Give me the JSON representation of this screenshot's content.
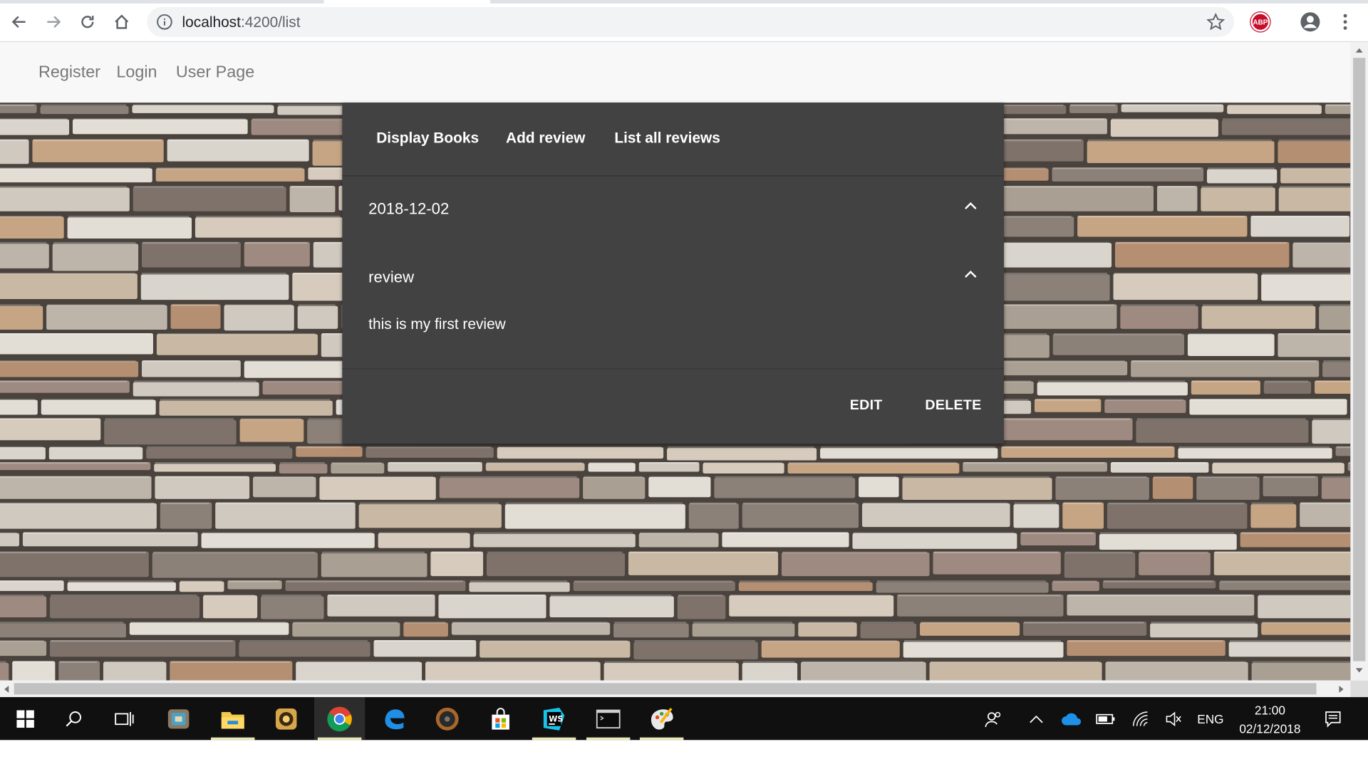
{
  "browser": {
    "url_host": "localhost",
    "url_rest": ":4200/list",
    "back_icon": "arrow-left-icon",
    "forward_icon": "arrow-right-icon",
    "reload_icon": "reload-icon",
    "home_icon": "home-icon",
    "extension_label": "ABP"
  },
  "app_nav": {
    "items": [
      {
        "label": "Register"
      },
      {
        "label": "Login"
      },
      {
        "label": "User Page"
      }
    ]
  },
  "card": {
    "tabs": [
      {
        "label": "Display Books"
      },
      {
        "label": "Add review"
      },
      {
        "label": "List all reviews"
      }
    ],
    "date_panel_title": "2018-12-02",
    "review_panel_title": "review",
    "review_text": "this is my first review",
    "edit_label": "EDIT",
    "delete_label": "DELETE"
  },
  "taskbar": {
    "language": "ENG",
    "time": "21:00",
    "date": "02/12/2018",
    "apps": [
      "start-icon",
      "search-icon",
      "task-view-icon",
      "app-icon",
      "file-explorer-icon",
      "app-icon",
      "chrome-icon",
      "edge-icon",
      "media-icon",
      "store-icon",
      "webstorm-icon",
      "terminal-icon",
      "paint-icon"
    ]
  },
  "colors": {
    "card_bg": "#424242",
    "nav_bg": "#f8f8f8",
    "nav_text": "#777777",
    "taskbar_bg": "#101010",
    "abp_red": "#c70d2c"
  }
}
